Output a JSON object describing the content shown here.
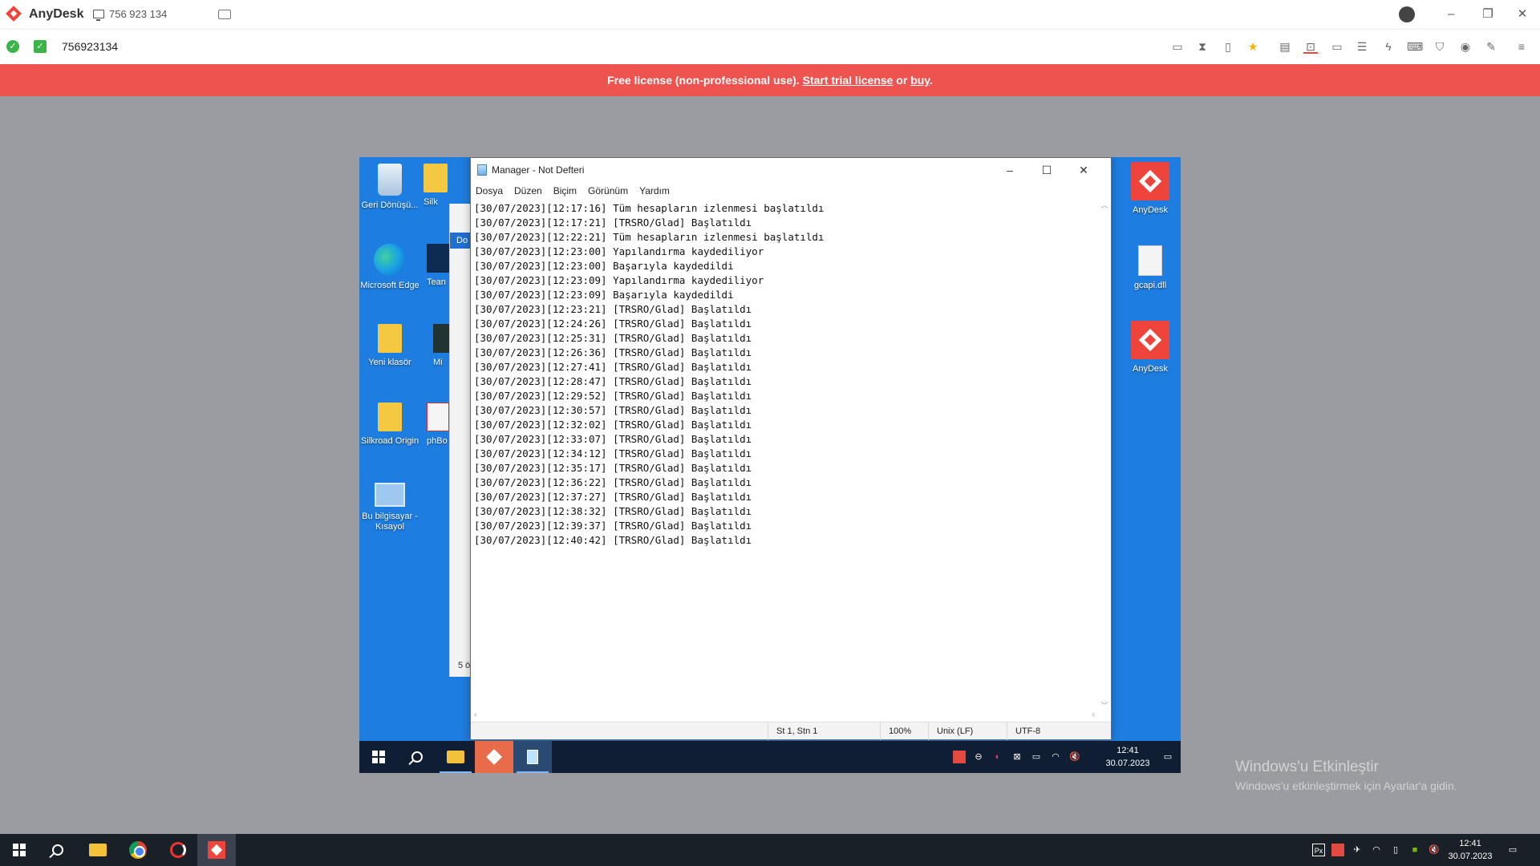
{
  "anydesk": {
    "app_name": "AnyDesk",
    "tab_id": "756 923 134",
    "address": "756923134",
    "brand_color": "#ef443b",
    "toolbar_icons": [
      "chat-icon",
      "hourglass-icon",
      "clipboard-icon",
      "star-icon",
      "file-transfer-icon",
      "display-icon",
      "monitor-icon",
      "message-icon",
      "lightning-icon",
      "keyboard-icon",
      "shield-icon",
      "record-icon",
      "draw-icon",
      "menu-icon"
    ]
  },
  "license_banner": {
    "text": "Free license (non-professional use).",
    "trial_link": "Start trial license",
    "or": "or",
    "buy_link": "buy",
    "period": ".",
    "color": "#ef5350"
  },
  "desktop_left": [
    {
      "label": "Geri Dönüşü...",
      "icon": "recycle-bin-icon"
    },
    {
      "label": "Microsoft Edge",
      "icon": "edge-icon"
    },
    {
      "label": "Yeni klasör",
      "icon": "folder-icon"
    },
    {
      "label": "Silkroad Origin",
      "icon": "folder-icon"
    },
    {
      "label": "Bu bilgisayar - Kısayol",
      "icon": "computer-icon"
    }
  ],
  "desktop_col2": [
    {
      "label": "Silk",
      "icon": "folder-icon"
    },
    {
      "label": "Tean",
      "icon": "teamviewer-icon"
    },
    {
      "label": "Mi",
      "icon": "app-icon"
    },
    {
      "label": "phBo",
      "icon": "app-icon"
    }
  ],
  "desktop_right": [
    {
      "label": "AnyDesk",
      "icon": "anydesk-icon"
    },
    {
      "label": "gcapi.dll",
      "icon": "dll-file-icon"
    },
    {
      "label": "AnyDesk",
      "icon": "anydesk-shortcut-icon"
    }
  ],
  "explorer": {
    "tab_fragment": "Do",
    "status_fragment": "5 ö"
  },
  "notepad": {
    "title": "Manager - Not Defteri",
    "menu": [
      "Dosya",
      "Düzen",
      "Biçim",
      "Görünüm",
      "Yardım"
    ],
    "lines": [
      "[30/07/2023][12:17:16] Tüm hesapların izlenmesi başlatıldı",
      "[30/07/2023][12:17:21] [TRSRO/Glad] Başlatıldı",
      "[30/07/2023][12:22:21] Tüm hesapların izlenmesi başlatıldı",
      "[30/07/2023][12:23:00] Yapılandırma kaydediliyor",
      "[30/07/2023][12:23:00] Başarıyla kaydedildi",
      "[30/07/2023][12:23:09] Yapılandırma kaydediliyor",
      "[30/07/2023][12:23:09] Başarıyla kaydedildi",
      "[30/07/2023][12:23:21] [TRSRO/Glad] Başlatıldı",
      "[30/07/2023][12:24:26] [TRSRO/Glad] Başlatıldı",
      "[30/07/2023][12:25:31] [TRSRO/Glad] Başlatıldı",
      "[30/07/2023][12:26:36] [TRSRO/Glad] Başlatıldı",
      "[30/07/2023][12:27:41] [TRSRO/Glad] Başlatıldı",
      "[30/07/2023][12:28:47] [TRSRO/Glad] Başlatıldı",
      "[30/07/2023][12:29:52] [TRSRO/Glad] Başlatıldı",
      "[30/07/2023][12:30:57] [TRSRO/Glad] Başlatıldı",
      "[30/07/2023][12:32:02] [TRSRO/Glad] Başlatıldı",
      "[30/07/2023][12:33:07] [TRSRO/Glad] Başlatıldı",
      "[30/07/2023][12:34:12] [TRSRO/Glad] Başlatıldı",
      "[30/07/2023][12:35:17] [TRSRO/Glad] Başlatıldı",
      "[30/07/2023][12:36:22] [TRSRO/Glad] Başlatıldı",
      "[30/07/2023][12:37:27] [TRSRO/Glad] Başlatıldı",
      "[30/07/2023][12:38:32] [TRSRO/Glad] Başlatıldı",
      "[30/07/2023][12:39:37] [TRSRO/Glad] Başlatıldı",
      "[30/07/2023][12:40:42] [TRSRO/Glad] Başlatıldı"
    ],
    "status": {
      "position": "St 1, Stn 1",
      "zoom": "100%",
      "line_ending": "Unix (LF)",
      "encoding": "UTF-8"
    }
  },
  "remote_taskbar": {
    "time": "12:41",
    "date": "30.07.2023"
  },
  "activation": {
    "title": "Windows'u Etkinleştir",
    "subtitle": "Windows'u etkinleştirmek için Ayarlar'a gidin."
  },
  "local_taskbar": {
    "time": "12:41",
    "date": "30.07.2023"
  }
}
